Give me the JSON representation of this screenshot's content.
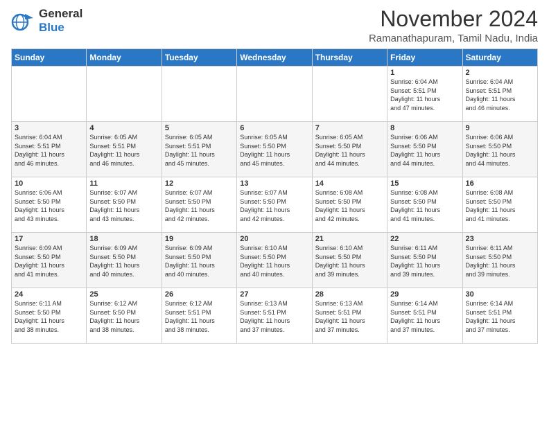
{
  "logo": {
    "line1": "General",
    "line2": "Blue"
  },
  "header": {
    "month": "November 2024",
    "location": "Ramanathapuram, Tamil Nadu, India"
  },
  "weekdays": [
    "Sunday",
    "Monday",
    "Tuesday",
    "Wednesday",
    "Thursday",
    "Friday",
    "Saturday"
  ],
  "weeks": [
    [
      {
        "day": "",
        "info": ""
      },
      {
        "day": "",
        "info": ""
      },
      {
        "day": "",
        "info": ""
      },
      {
        "day": "",
        "info": ""
      },
      {
        "day": "",
        "info": ""
      },
      {
        "day": "1",
        "info": "Sunrise: 6:04 AM\nSunset: 5:51 PM\nDaylight: 11 hours\nand 47 minutes."
      },
      {
        "day": "2",
        "info": "Sunrise: 6:04 AM\nSunset: 5:51 PM\nDaylight: 11 hours\nand 46 minutes."
      }
    ],
    [
      {
        "day": "3",
        "info": "Sunrise: 6:04 AM\nSunset: 5:51 PM\nDaylight: 11 hours\nand 46 minutes."
      },
      {
        "day": "4",
        "info": "Sunrise: 6:05 AM\nSunset: 5:51 PM\nDaylight: 11 hours\nand 46 minutes."
      },
      {
        "day": "5",
        "info": "Sunrise: 6:05 AM\nSunset: 5:51 PM\nDaylight: 11 hours\nand 45 minutes."
      },
      {
        "day": "6",
        "info": "Sunrise: 6:05 AM\nSunset: 5:50 PM\nDaylight: 11 hours\nand 45 minutes."
      },
      {
        "day": "7",
        "info": "Sunrise: 6:05 AM\nSunset: 5:50 PM\nDaylight: 11 hours\nand 44 minutes."
      },
      {
        "day": "8",
        "info": "Sunrise: 6:06 AM\nSunset: 5:50 PM\nDaylight: 11 hours\nand 44 minutes."
      },
      {
        "day": "9",
        "info": "Sunrise: 6:06 AM\nSunset: 5:50 PM\nDaylight: 11 hours\nand 44 minutes."
      }
    ],
    [
      {
        "day": "10",
        "info": "Sunrise: 6:06 AM\nSunset: 5:50 PM\nDaylight: 11 hours\nand 43 minutes."
      },
      {
        "day": "11",
        "info": "Sunrise: 6:07 AM\nSunset: 5:50 PM\nDaylight: 11 hours\nand 43 minutes."
      },
      {
        "day": "12",
        "info": "Sunrise: 6:07 AM\nSunset: 5:50 PM\nDaylight: 11 hours\nand 42 minutes."
      },
      {
        "day": "13",
        "info": "Sunrise: 6:07 AM\nSunset: 5:50 PM\nDaylight: 11 hours\nand 42 minutes."
      },
      {
        "day": "14",
        "info": "Sunrise: 6:08 AM\nSunset: 5:50 PM\nDaylight: 11 hours\nand 42 minutes."
      },
      {
        "day": "15",
        "info": "Sunrise: 6:08 AM\nSunset: 5:50 PM\nDaylight: 11 hours\nand 41 minutes."
      },
      {
        "day": "16",
        "info": "Sunrise: 6:08 AM\nSunset: 5:50 PM\nDaylight: 11 hours\nand 41 minutes."
      }
    ],
    [
      {
        "day": "17",
        "info": "Sunrise: 6:09 AM\nSunset: 5:50 PM\nDaylight: 11 hours\nand 41 minutes."
      },
      {
        "day": "18",
        "info": "Sunrise: 6:09 AM\nSunset: 5:50 PM\nDaylight: 11 hours\nand 40 minutes."
      },
      {
        "day": "19",
        "info": "Sunrise: 6:09 AM\nSunset: 5:50 PM\nDaylight: 11 hours\nand 40 minutes."
      },
      {
        "day": "20",
        "info": "Sunrise: 6:10 AM\nSunset: 5:50 PM\nDaylight: 11 hours\nand 40 minutes."
      },
      {
        "day": "21",
        "info": "Sunrise: 6:10 AM\nSunset: 5:50 PM\nDaylight: 11 hours\nand 39 minutes."
      },
      {
        "day": "22",
        "info": "Sunrise: 6:11 AM\nSunset: 5:50 PM\nDaylight: 11 hours\nand 39 minutes."
      },
      {
        "day": "23",
        "info": "Sunrise: 6:11 AM\nSunset: 5:50 PM\nDaylight: 11 hours\nand 39 minutes."
      }
    ],
    [
      {
        "day": "24",
        "info": "Sunrise: 6:11 AM\nSunset: 5:50 PM\nDaylight: 11 hours\nand 38 minutes."
      },
      {
        "day": "25",
        "info": "Sunrise: 6:12 AM\nSunset: 5:50 PM\nDaylight: 11 hours\nand 38 minutes."
      },
      {
        "day": "26",
        "info": "Sunrise: 6:12 AM\nSunset: 5:51 PM\nDaylight: 11 hours\nand 38 minutes."
      },
      {
        "day": "27",
        "info": "Sunrise: 6:13 AM\nSunset: 5:51 PM\nDaylight: 11 hours\nand 37 minutes."
      },
      {
        "day": "28",
        "info": "Sunrise: 6:13 AM\nSunset: 5:51 PM\nDaylight: 11 hours\nand 37 minutes."
      },
      {
        "day": "29",
        "info": "Sunrise: 6:14 AM\nSunset: 5:51 PM\nDaylight: 11 hours\nand 37 minutes."
      },
      {
        "day": "30",
        "info": "Sunrise: 6:14 AM\nSunset: 5:51 PM\nDaylight: 11 hours\nand 37 minutes."
      }
    ]
  ]
}
